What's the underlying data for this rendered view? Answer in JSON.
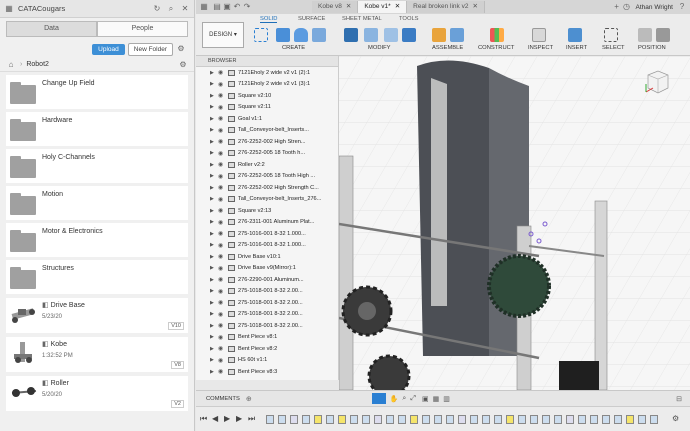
{
  "app": {
    "team": "CATACougars",
    "user": "Athan Wright",
    "colors": {
      "accent": "#3d8fd6",
      "highlight": "#1f6fb8",
      "timeline_highlight": "#f5e56b"
    }
  },
  "data_panel": {
    "tabs": [
      {
        "label": "Data",
        "active": true
      },
      {
        "label": "People",
        "active": false
      }
    ],
    "upload_label": "Upload",
    "new_folder_label": "New Folder",
    "breadcrumb": "Robot2",
    "folders": [
      {
        "name": "Change Up Field"
      },
      {
        "name": "Hardware"
      },
      {
        "name": "Holy C-Channels"
      },
      {
        "name": "Motion"
      },
      {
        "name": "Motor & Electronics"
      },
      {
        "name": "Structures"
      }
    ],
    "designs": [
      {
        "name": "Drive Base",
        "date": "5/23/20",
        "version": "V10"
      },
      {
        "name": "Kobe",
        "date": "1:32:52 PM",
        "version": "V8"
      },
      {
        "name": "Roller",
        "date": "5/20/20",
        "version": "V2"
      }
    ]
  },
  "doc_tabs": [
    {
      "label": "Kobe v8",
      "active": false
    },
    {
      "label": "Kobe v1*",
      "active": true
    },
    {
      "label": "Real broken link v2",
      "active": false
    }
  ],
  "toolbar": {
    "workspace_label": "DESIGN",
    "workspace_tabs": [
      "SOLID",
      "SURFACE",
      "SHEET METAL",
      "TOOLS"
    ],
    "groups": [
      "CREATE",
      "MODIFY",
      "ASSEMBLE",
      "CONSTRUCT",
      "INSPECT",
      "INSERT",
      "SELECT",
      "POSITION"
    ]
  },
  "browser": {
    "title": "BROWSER",
    "items": [
      "7121Eholy 2 wide v2 v1 (2):1",
      "7121Eholy 2 wide v2 v1 (3):1",
      "Square v2:10",
      "Square v2:11",
      "Goal v1:1",
      "Tall_Conveyor-belt_Inserts...",
      "276-2252-002 High Stren...",
      "276-2252-005 18 Tooth h...",
      "Roller v2:2",
      "276-2252-005 18 Tooth High ...",
      "276-2252-002 High Strength C...",
      "Tall_Conveyor-belt_Inserts_276...",
      "Square v2:13",
      "276-2311-001 Aluminum Plat...",
      "275-1016-001 8-32 1.000...",
      "275-1016-001 8-32 1.000...",
      "Drive Base v10:1",
      "Drive Base v9(Mirror):1",
      "276-2290-001 Aluminum...",
      "275-1018-001 8-32 2.00...",
      "275-1018-001 8-32 2.00...",
      "275-1018-001 8-32 2.00...",
      "275-1018-001 8-32 2.00...",
      "Bent Piece v8:1",
      "Bent Piece v8:2",
      "HS 60t v1:1",
      "Bent Piece v8:3"
    ]
  },
  "comments_label": "COMMENTS"
}
